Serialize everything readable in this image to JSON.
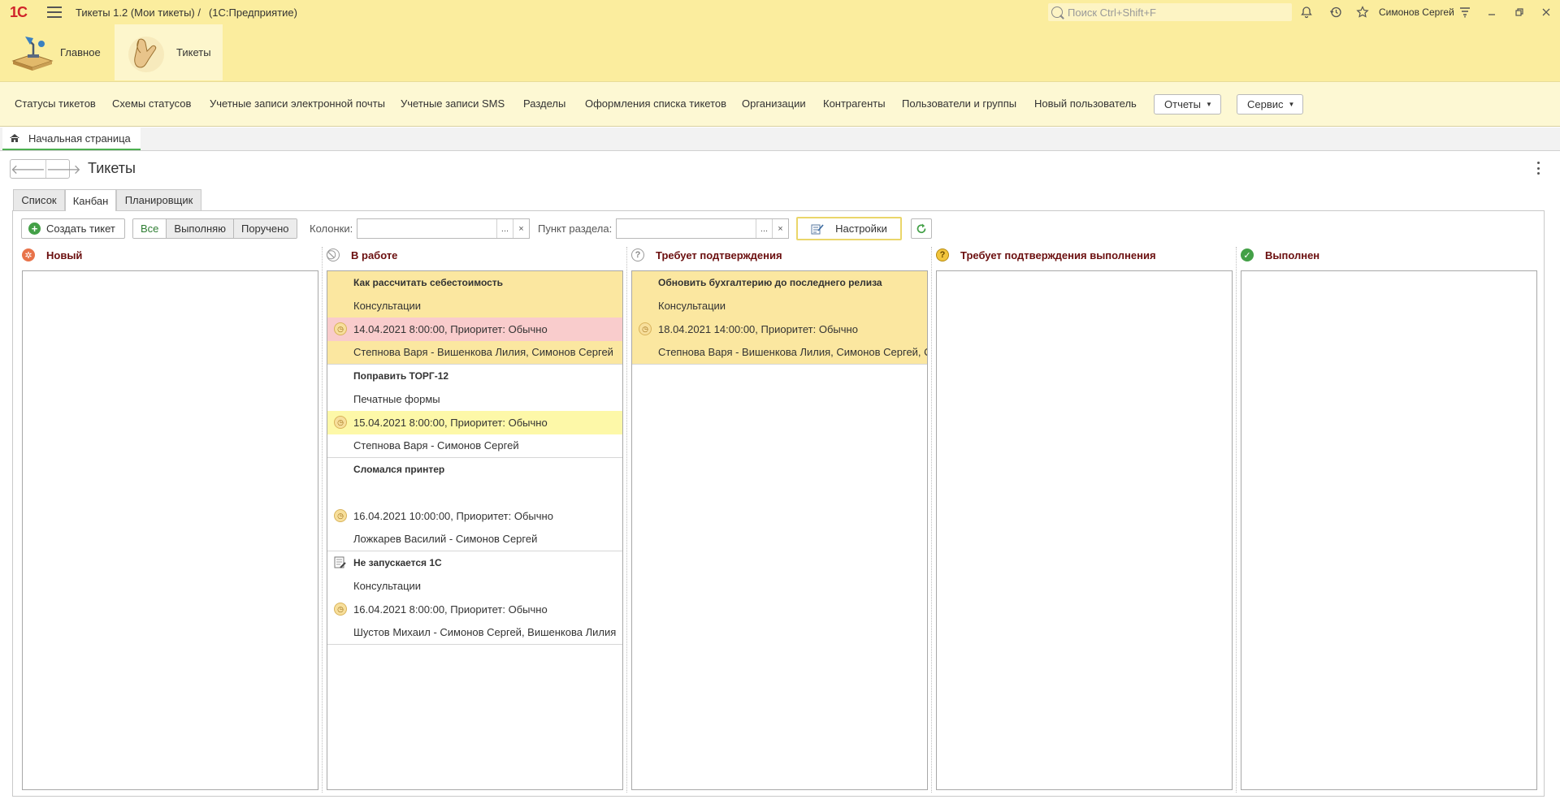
{
  "titlebar": {
    "logo": "1С",
    "title": "Тикеты 1.2 (Мои тикеты) /",
    "app": "(1С:Предприятие)",
    "search_placeholder": "Поиск Ctrl+Shift+F",
    "user": "Симонов Сергей"
  },
  "sections": [
    {
      "label": "Главное",
      "icon": "desk-lamp-icon"
    },
    {
      "label": "Тикеты",
      "icon": "hand-icon"
    }
  ],
  "commands": [
    "Статусы тикетов",
    "Схемы статусов",
    "Учетные записи электронной почты",
    "Учетные записи SMS",
    "Разделы",
    "Оформления списка тикетов",
    "Организации",
    "Контрагенты",
    "Пользователи и группы",
    "Новый пользователь"
  ],
  "command_menus": {
    "reports": "Отчеты",
    "service": "Сервис"
  },
  "open_tabs": {
    "home": "Начальная страница"
  },
  "form": {
    "title": "Тикеты"
  },
  "view_tabs": [
    "Список",
    "Канбан",
    "Планировщик"
  ],
  "active_view_tab": "Канбан",
  "toolbar": {
    "create": "Создать тикет",
    "filters": [
      "Все",
      "Выполняю",
      "Поручено"
    ],
    "active_filter": "Все",
    "columns_label": "Колонки:",
    "columns_value": "",
    "section_label": "Пункт раздела:",
    "section_value": "",
    "select_glyph": "...",
    "clear_glyph": "×",
    "settings": "Настройки"
  },
  "colors": {
    "accent_yellow": "#fbed9e",
    "column_header": "#6b0f0f",
    "card_yellow": "#fbe7a0",
    "card_red": "#f9cccc",
    "card_light_yellow": "#fdf8a8",
    "green": "#43a047"
  },
  "kanban": {
    "columns": [
      {
        "title": "Новый",
        "icon": "new-star-icon",
        "cards": []
      },
      {
        "title": "В работе",
        "icon": "in-progress-icon",
        "cards": [
          {
            "title": "Как рассчитать себестоимость",
            "section": "Консультации",
            "date": "14.04.2021 8:00:00, Приоритет: Обычно",
            "people": "Степнова Варя - Вишенкова Лилия, Симонов Сергей",
            "highlight": "yellow",
            "date_highlight": "red"
          },
          {
            "title": "Поправить ТОРГ-12",
            "section": "Печатные формы",
            "date": "15.04.2021 8:00:00, Приоритет: Обычно",
            "people": "Степнова Варя - Симонов Сергей",
            "highlight": "none",
            "date_highlight": "light-yellow"
          },
          {
            "title": "Сломался принтер",
            "section": "",
            "date": "16.04.2021 10:00:00, Приоритет: Обычно",
            "people": "Ложкарев Василий - Симонов Сергей",
            "highlight": "none",
            "date_highlight": "none"
          },
          {
            "title": "Не запускается 1С",
            "section": "Консультации",
            "date": "16.04.2021 8:00:00, Приоритет: Обычно",
            "people": "Шустов Михаил - Симонов Сергей, Вишенкова Лилия",
            "highlight": "none",
            "date_highlight": "none",
            "title_icon": "wrench-icon"
          }
        ]
      },
      {
        "title": "Требует подтверждения",
        "icon": "question-icon",
        "cards": [
          {
            "title": "Обновить бухгалтерию до последнего релиза",
            "section": "Консультации",
            "date": "18.04.2021 14:00:00, Приоритет: Обычно",
            "people": "Степнова Варя - Вишенкова Лилия, Симонов Сергей, С",
            "highlight": "yellow",
            "date_highlight": "yellow"
          }
        ]
      },
      {
        "title": "Требует подтверждения выполнения",
        "icon": "question-yellow-icon",
        "cards": []
      },
      {
        "title": "Выполнен",
        "icon": "check-icon",
        "cards": []
      }
    ]
  }
}
